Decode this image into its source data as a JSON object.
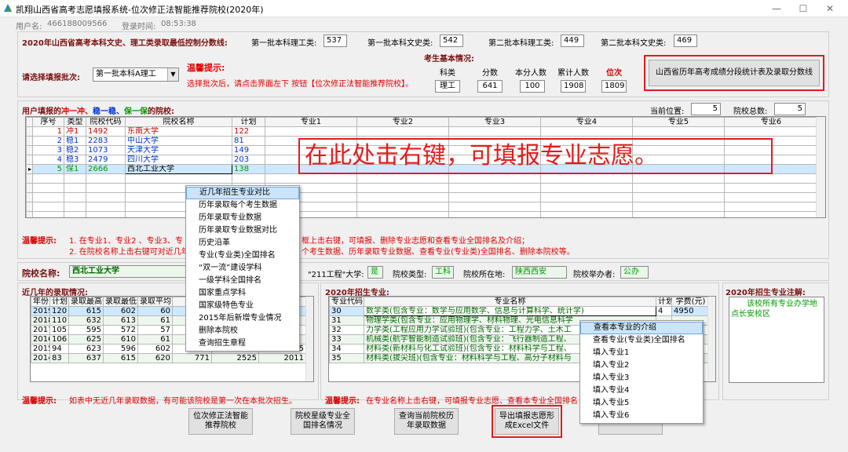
{
  "window": {
    "title": "凯翔山西省高考志愿填报系统-位次修正法智能推荐院校(2020年)"
  },
  "userbar": {
    "user_label": "用户名:",
    "user_value": "466188009566",
    "time_label": "登录时间:",
    "time_value": "08:53:38"
  },
  "scores": {
    "heading": "2020年山西省高考本科文史、理工类录取最低控制分数线:",
    "items": [
      {
        "label": "第一批本科理工类:",
        "value": "537"
      },
      {
        "label": "第一批本科文史类:",
        "value": "542"
      },
      {
        "label": "第二批本科理工类:",
        "value": "449"
      },
      {
        "label": "第二批本科文史类:",
        "value": "469"
      }
    ]
  },
  "batch": {
    "label": "请选择填报批次:",
    "value": "第一批本科A理工"
  },
  "tip1": {
    "title": "温馨提示:",
    "text": "选择批次后，请点击界面左下 按钮【位次修正法智能推荐院校】。"
  },
  "student": {
    "title": "考生基本情况:",
    "headers": [
      "科类",
      "分数",
      "本分人数",
      "累计人数",
      "位次"
    ],
    "values": [
      "理工",
      "641",
      "100",
      "1908",
      "1809"
    ]
  },
  "history_button": "山西省历年高考成绩分段统计表及录取分数线",
  "colleges": {
    "title_prefix": "用户填报的",
    "title_a": "冲一冲、",
    "title_b": "稳一稳、",
    "title_c": "保一保",
    "title_suffix": "的院校:",
    "current_label": "当前位置:",
    "current_value": "5",
    "total_label": "院校总数:",
    "total_value": "5",
    "headers": [
      "序号",
      "类型",
      "院校代码",
      "院校名称",
      "计划",
      "专业1",
      "专业2",
      "专业3",
      "专业4",
      "专业5",
      "专业6"
    ],
    "rows": [
      {
        "no": "1",
        "type": "冲1",
        "code": "1492",
        "name": "东南大学",
        "plan": "122",
        "color": "#d00000"
      },
      {
        "no": "2",
        "type": "稳1",
        "code": "2283",
        "name": "中山大学",
        "plan": "81",
        "color": "#0033cc"
      },
      {
        "no": "3",
        "type": "稳2",
        "code": "1073",
        "name": "天津大学",
        "plan": "149",
        "color": "#0033cc"
      },
      {
        "no": "4",
        "type": "稳3",
        "code": "2479",
        "name": "四川大学",
        "plan": "203",
        "color": "#0033cc"
      },
      {
        "no": "5",
        "type": "保1",
        "code": "2666",
        "name": "西北工业大学",
        "plan": "138",
        "color": "#009900"
      }
    ],
    "overlay": "在此处击右键，可填报专业志愿。"
  },
  "context_menu_1": {
    "items": [
      "近几年招生专业对比",
      "历年录取每个考生数据",
      "历年录取专业数据",
      "历年录取专业数据对比",
      "历史沿革",
      "专业(专业类)全国排名",
      "“双一流”建设学科",
      "一级学科全国排名",
      "国家重点学科",
      "国家级特色专业",
      "2015年后新增专业情况",
      "删除本院校",
      "查询招生章程"
    ],
    "selected": 0
  },
  "tip2": {
    "title": "温馨提示:",
    "line1_a": "1. 在专业1、专业2 、专业3、专",
    "line1_b": "框上击右键，可填报、删除专业志愿和查看专业全国排名及介绍；",
    "line2_a": "2. 在院校名称上击右键可对近几年",
    "line2_b": "个考生数据、历年录取专业数据、查看专业(专业类)全国排名、删除本院校等。"
  },
  "college_info": {
    "name_label": "院校名称:",
    "name_value": "西北工业大学",
    "p211_label": "\"211工程\"大学:",
    "p211_value": "是",
    "type_label": "院校类型:",
    "type_value": "工科",
    "loc_label": "院校所在地:",
    "loc_value": "陕西西安",
    "owner_label": "院校举办者:",
    "owner_value": "公办"
  },
  "history": {
    "title": "近几年的录取情况:",
    "headers": [
      "年份",
      "计划",
      "录取最高分",
      "录取最低分",
      "录取平均"
    ],
    "rows": [
      [
        "2019",
        "120",
        "615",
        "602",
        "60"
      ],
      [
        "2018",
        "110",
        "632",
        "613",
        "61"
      ],
      [
        "2017",
        "105",
        "595",
        "572",
        "57"
      ],
      [
        "2016",
        "106",
        "625",
        "610",
        "61"
      ],
      [
        "2015",
        "94",
        "623",
        "596",
        "602",
        "922",
        "2944",
        "2305"
      ],
      [
        "2014",
        "83",
        "637",
        "615",
        "620",
        "771",
        "2525",
        "2011"
      ]
    ]
  },
  "majors": {
    "title": "2020年招生专业:",
    "headers": [
      "专业代码",
      "专业名称",
      "计划",
      "学费(元)"
    ],
    "rows": [
      [
        "30",
        "数学类(包含专业：数学与应用数学、信息与计算科学、统计学)",
        "4",
        "4950"
      ],
      [
        "31",
        "物理学类(包含专业：应用物理学、材料物理、光电信息科学",
        "",
        ""
      ],
      [
        "32",
        "力学类(工程应用力学试验班)(包含专业：工程力学、土木工",
        "",
        ""
      ],
      [
        "33",
        "机械类(航宇智能制造试验班)(包含专业：飞行器制造工程、",
        "",
        ""
      ],
      [
        "34",
        "材料类(新材料与化工试验班)(包含专业：材料科学与工程、",
        "",
        ""
      ],
      [
        "35",
        "材料类(拔尖班)(包含专业：材料科学与工程、高分子材料与",
        "",
        ""
      ]
    ]
  },
  "notes": {
    "title": "2020年招生专业注解:",
    "text": "该校所有专业办学地点长安校区"
  },
  "context_menu_2": {
    "items": [
      "查看本专业的介绍",
      "查看专业(专业类)全国排名",
      "填入专业1",
      "填入专业2",
      "填入专业3",
      "填入专业4",
      "填入专业5",
      "填入专业6"
    ],
    "selected": 0
  },
  "tip3": {
    "title": "温馨提示:",
    "left": "如表中无近几年录取数据，有可能该院校是第一次在本批次招生。",
    "right": "在专业名称上击右键，可填报专业志愿、查看本专业全国排名"
  },
  "buttons": {
    "b1": "位次修正法智能\n推荐院校",
    "b2": "院校星级专业全\n国排名情况",
    "b3": "查询当前院校历\n年录取数据",
    "b4": "导出填报志愿形\n成Excel文件"
  },
  "colors": {
    "red": "#d00000",
    "blue": "#0033cc",
    "green": "#009900",
    "frame": "#e21c1c"
  }
}
